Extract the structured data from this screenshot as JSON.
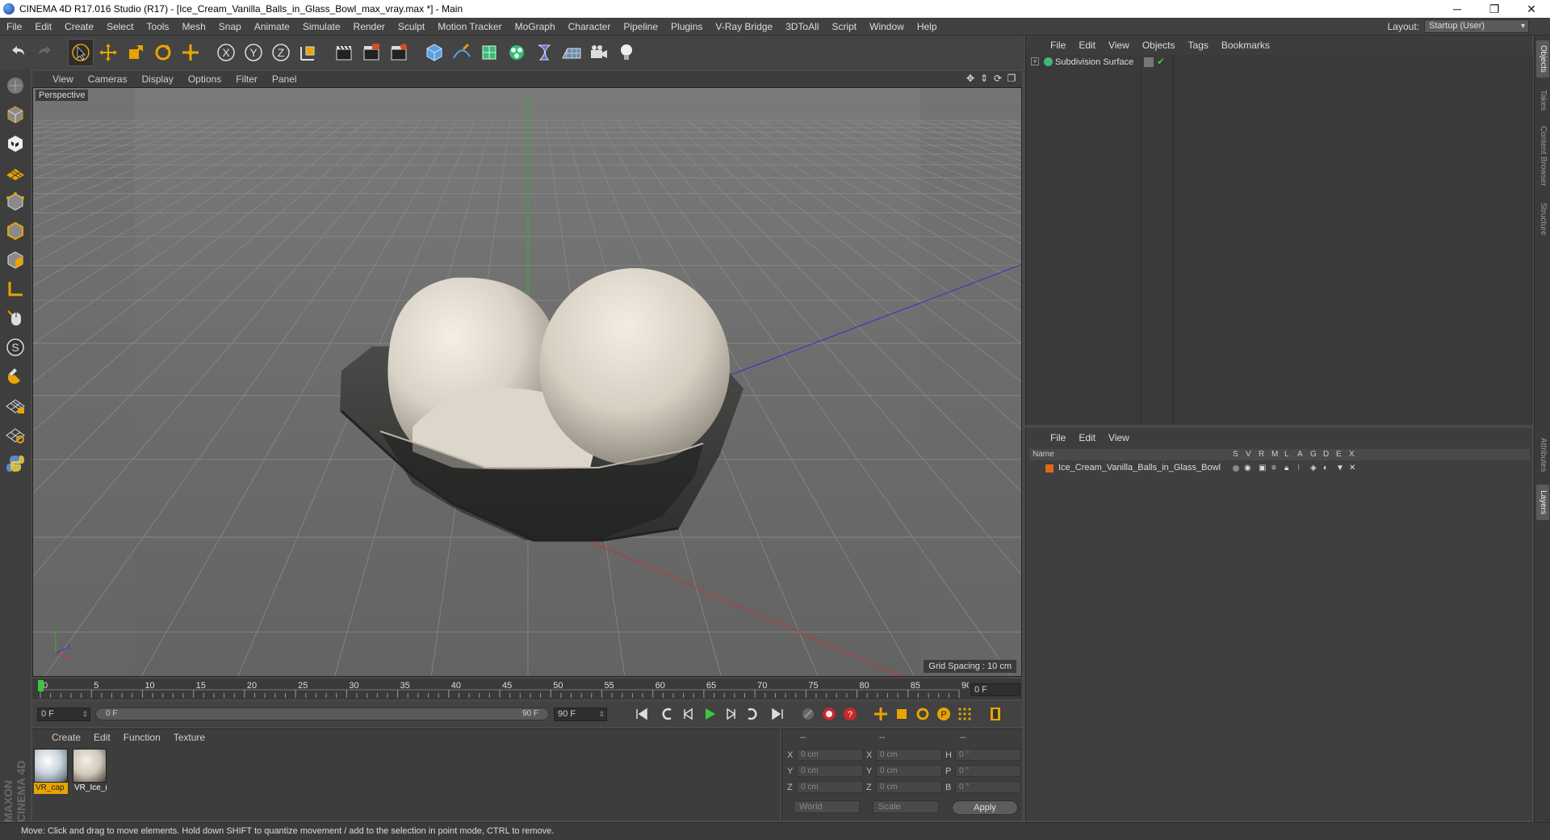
{
  "window": {
    "title": "CINEMA 4D R17.016 Studio (R17) - [Ice_Cream_Vanilla_Balls_in_Glass_Bowl_max_vray.max *] - Main",
    "minimize": "─",
    "restore": "❐",
    "close": "✕"
  },
  "menubar": {
    "items": [
      "File",
      "Edit",
      "Create",
      "Select",
      "Tools",
      "Mesh",
      "Snap",
      "Animate",
      "Simulate",
      "Render",
      "Sculpt",
      "Motion Tracker",
      "MoGraph",
      "Character",
      "Pipeline",
      "Plugins",
      "V-Ray Bridge",
      "3DToAll",
      "Script",
      "Window",
      "Help"
    ],
    "layout_label": "Layout:",
    "layout_value": "Startup (User)"
  },
  "viewport": {
    "menu": [
      "View",
      "Cameras",
      "Display",
      "Options",
      "Filter",
      "Panel"
    ],
    "camera_label": "Perspective",
    "grid_spacing": "Grid Spacing : 10 cm",
    "axis_y": "y",
    "axis_x": "x",
    "axis_z": "z"
  },
  "timeline": {
    "ticks": [
      "0",
      "5",
      "10",
      "15",
      "20",
      "25",
      "30",
      "35",
      "40",
      "45",
      "50",
      "55",
      "60",
      "65",
      "70",
      "75",
      "80",
      "85",
      "90"
    ],
    "current_frame": "0 F"
  },
  "playback": {
    "start_field": "0 F",
    "range_start": "0 F",
    "range_end": "90 F",
    "end_field": "90 F"
  },
  "materials": {
    "menu": [
      "Create",
      "Edit",
      "Function",
      "Texture"
    ],
    "items": [
      {
        "name": "VR_cap"
      },
      {
        "name": "VR_Ice_("
      }
    ]
  },
  "coordinates": {
    "header": [
      "--",
      "--",
      "--"
    ],
    "rows": [
      {
        "a": "X",
        "v1": "0 cm",
        "b": "X",
        "v2": "0 cm",
        "c": "H",
        "v3": "0 °"
      },
      {
        "a": "Y",
        "v1": "0 cm",
        "b": "Y",
        "v2": "0 cm",
        "c": "P",
        "v3": "0 °"
      },
      {
        "a": "Z",
        "v1": "0 cm",
        "b": "Z",
        "v2": "0 cm",
        "c": "B",
        "v3": "0 °"
      }
    ],
    "space": "World",
    "mode": "Scale",
    "apply": "Apply"
  },
  "objects_panel": {
    "menu": [
      "File",
      "Edit",
      "View",
      "Objects",
      "Tags",
      "Bookmarks"
    ],
    "object_name": "Subdivision Surface"
  },
  "layers_panel": {
    "menu": [
      "File",
      "Edit",
      "View"
    ],
    "columns": [
      "Name",
      "S",
      "V",
      "R",
      "M",
      "L",
      "A",
      "G",
      "D",
      "E",
      "X"
    ],
    "layer_name": "Ice_Cream_Vanilla_Balls_in_Glass_Bowl",
    "layer_color": "#e06a1a"
  },
  "right_tabs": [
    "Objects",
    "Takes",
    "Content Browser",
    "Structure",
    "Attributes",
    "Layers"
  ],
  "brand": "MAXON CINEMA 4D",
  "status": "Move: Click and drag to move elements. Hold down SHIFT to quantize movement / add to the selection in point mode, CTRL to remove.",
  "colors": {
    "accent_orange": "#e8a400",
    "axis_x": "#c83232",
    "axis_y": "#32b432",
    "axis_z": "#3232c8"
  }
}
